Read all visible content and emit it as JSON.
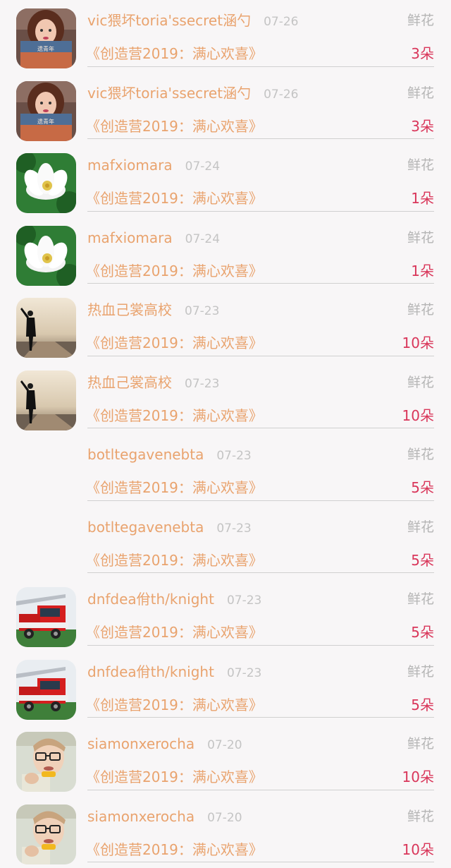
{
  "records": [
    {
      "avatar": "avatar-girl",
      "name": "vic猥坏toria'ssecret涵勺",
      "date": "07-26",
      "gift": "鲜花",
      "album": "《创造营2019：满心欢喜》",
      "count": "3朵"
    },
    {
      "avatar": "avatar-girl",
      "name": "vic猥坏toria'ssecret涵勺",
      "date": "07-26",
      "gift": "鲜花",
      "album": "《创造营2019：满心欢喜》",
      "count": "3朵"
    },
    {
      "avatar": "avatar-lotus",
      "name": "mafxiomara",
      "date": "07-24",
      "gift": "鲜花",
      "album": "《创造营2019：满心欢喜》",
      "count": "1朵"
    },
    {
      "avatar": "avatar-lotus",
      "name": "mafxiomara",
      "date": "07-24",
      "gift": "鲜花",
      "album": "《创造营2019：满心欢喜》",
      "count": "1朵"
    },
    {
      "avatar": "avatar-silhouette",
      "name": "热血己裳高校",
      "date": "07-23",
      "gift": "鲜花",
      "album": "《创造营2019：满心欢喜》",
      "count": "10朵"
    },
    {
      "avatar": "avatar-silhouette",
      "name": "热血己裳高校",
      "date": "07-23",
      "gift": "鲜花",
      "album": "《创造营2019：满心欢喜》",
      "count": "10朵"
    },
    {
      "avatar": "none",
      "name": "botltegavenebta",
      "date": "07-23",
      "gift": "鲜花",
      "album": "《创造营2019：满心欢喜》",
      "count": "5朵"
    },
    {
      "avatar": "none",
      "name": "botltegavenebta",
      "date": "07-23",
      "gift": "鲜花",
      "album": "《创造营2019：满心欢喜》",
      "count": "5朵"
    },
    {
      "avatar": "avatar-firetruck",
      "name": "dnfdea佾th/knight",
      "date": "07-23",
      "gift": "鲜花",
      "album": "《创造营2019：满心欢喜》",
      "count": "5朵"
    },
    {
      "avatar": "avatar-firetruck",
      "name": "dnfdea佾th/knight",
      "date": "07-23",
      "gift": "鲜花",
      "album": "《创造营2019：满心欢喜》",
      "count": "5朵"
    },
    {
      "avatar": "avatar-glasses-guy",
      "name": "siamonxerocha",
      "date": "07-20",
      "gift": "鲜花",
      "album": "《创造营2019：满心欢喜》",
      "count": "10朵"
    },
    {
      "avatar": "avatar-glasses-guy",
      "name": "siamonxerocha",
      "date": "07-20",
      "gift": "鲜花",
      "album": "《创造营2019：满心欢喜》",
      "count": "10朵"
    }
  ],
  "avatar_overlay_text": "遗青年"
}
